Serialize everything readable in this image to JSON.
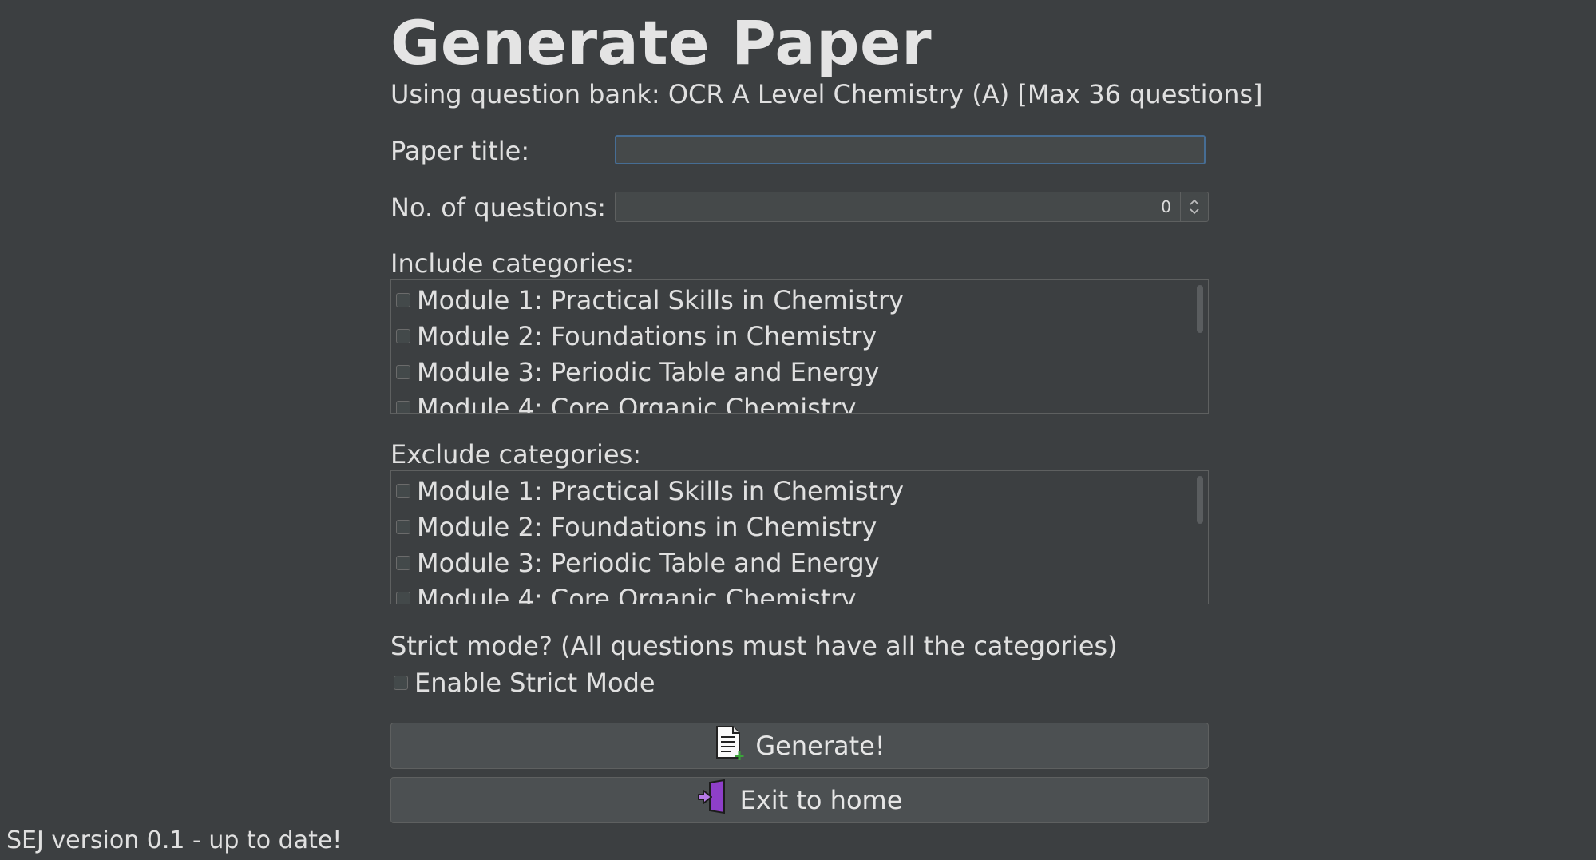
{
  "page": {
    "title": "Generate Paper",
    "question_bank_line": "Using question bank: OCR A Level Chemistry (A) [Max 36 questions]"
  },
  "form": {
    "paper_title_label": "Paper title:",
    "paper_title_value": "",
    "num_questions_label": "No. of questions:",
    "num_questions_value": "0"
  },
  "include": {
    "label": "Include categories:",
    "items": [
      {
        "label": "Module 1: Practical Skills in Chemistry",
        "checked": false
      },
      {
        "label": "Module 2: Foundations in Chemistry",
        "checked": false
      },
      {
        "label": "Module 3: Periodic Table and Energy",
        "checked": false
      },
      {
        "label": "Module 4: Core Organic Chemistry",
        "checked": false
      }
    ]
  },
  "exclude": {
    "label": "Exclude categories:",
    "items": [
      {
        "label": "Module 1: Practical Skills in Chemistry",
        "checked": false
      },
      {
        "label": "Module 2: Foundations in Chemistry",
        "checked": false
      },
      {
        "label": "Module 3: Periodic Table and Energy",
        "checked": false
      },
      {
        "label": "Module 4: Core Organic Chemistry",
        "checked": false
      }
    ]
  },
  "strict": {
    "question": "Strict mode? (All questions must have all the categories)",
    "checkbox_label": "Enable Strict Mode",
    "checked": false
  },
  "buttons": {
    "generate_label": "Generate!",
    "generate_icon": "document-add-icon",
    "exit_label": "Exit to home",
    "exit_icon": "exit-door-icon"
  },
  "footer": {
    "version_text": "SEJ version 0.1 - up to date!"
  },
  "colors": {
    "background": "#3c3f41",
    "focus_border": "#466d94",
    "exit_icon_purple": "#8e3fc9",
    "plus_green": "#3aa33a"
  }
}
